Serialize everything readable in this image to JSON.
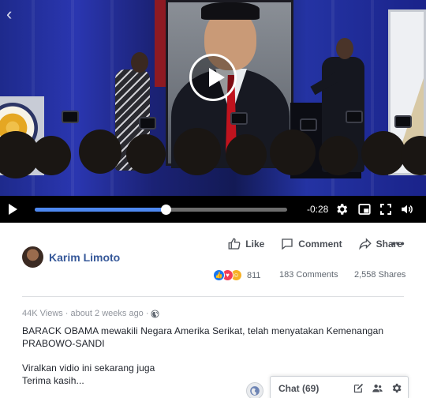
{
  "video": {
    "time_remaining": "-0:28",
    "progress_fraction": 0.52
  },
  "post": {
    "author": "Karim Limoto",
    "actions": {
      "like": "Like",
      "comment": "Comment",
      "share": "Share",
      "more": "•••"
    },
    "reactions_count": "811",
    "comments": "183 Comments",
    "shares": "2,558 Shares",
    "views": "44K Views",
    "time": "about 2 weeks ago",
    "text_lines": [
      "BARACK OBAMA mewakili Negara Amerika Serikat, telah menyatakan Kemenangan",
      "PRABOWO-SANDI",
      "",
      "Viralkan vidio ini sekarang juga",
      "Terima kasih..."
    ]
  },
  "chat": {
    "label": "Chat (69)"
  },
  "colors": {
    "link": "#365899",
    "progress": "#4d88f0",
    "like": "#1877f2",
    "love": "#f33e58",
    "haha": "#f7b125"
  },
  "icons": [
    "back-chevron-icon",
    "play-icon",
    "settings-gear-icon",
    "pip-icon",
    "fullscreen-icon",
    "volume-icon",
    "like-icon",
    "comment-icon",
    "share-icon",
    "globe-icon",
    "compose-icon",
    "people-icon",
    "gear-icon"
  ]
}
